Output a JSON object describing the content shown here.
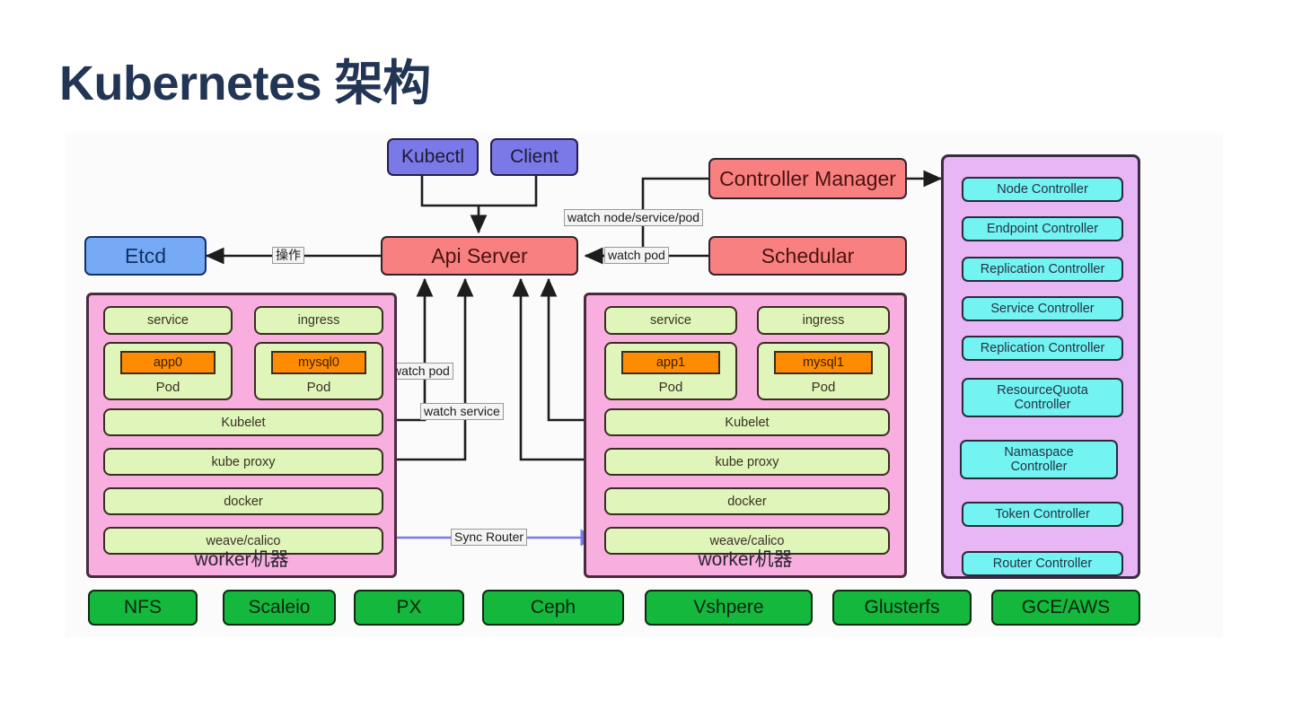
{
  "page": {
    "title": "Kubernetes 架构",
    "title_color": "#223555",
    "background": "#ffffff"
  },
  "colors": {
    "client_purple": "#7b78e8",
    "control_salmon": "#f98080",
    "etcd_blue": "#77aaf5",
    "controller_panel": "#e8b5f5",
    "controller_box": "#74f3f3",
    "worker_pink": "#f9aee0",
    "worker_green": "#dff5ba",
    "container_orange": "#ff8c00",
    "storage_green": "#14b83c",
    "sync_router_arrow": "#7b78e8"
  },
  "clients": [
    {
      "label": "Kubectl"
    },
    {
      "label": "Client"
    }
  ],
  "control_plane": {
    "api_server": "Api Server",
    "controller_manager": "Controller Manager",
    "schedular": "Schedular",
    "etcd": "Etcd"
  },
  "edge_labels": {
    "etcd_operation": "操作",
    "watch_node_service_pod": "watch node/service/pod",
    "watch_pod_schedular": "watch pod",
    "watch_pod_worker": "watch pod",
    "watch_service_worker": "watch service",
    "sync_router": "Sync Router"
  },
  "controllers": [
    {
      "label": "Node Controller",
      "lines": 1
    },
    {
      "label": "Endpoint Controller",
      "lines": 1
    },
    {
      "label": "Replication Controller",
      "lines": 1
    },
    {
      "label": "Service Controller",
      "lines": 1
    },
    {
      "label": "Replication Controller",
      "lines": 1
    },
    {
      "label": "ResourceQuota\nController",
      "lines": 2
    },
    {
      "label": "Namaspace\nController",
      "lines": 2
    },
    {
      "label": "Token Controller",
      "lines": 1
    },
    {
      "label": "Router Controller",
      "lines": 1
    }
  ],
  "workers": [
    {
      "title": "worker机器",
      "service": "service",
      "ingress": "ingress",
      "pods": [
        {
          "container": "app0",
          "label": "Pod"
        },
        {
          "container": "mysql0",
          "label": "Pod"
        }
      ],
      "components": [
        "Kubelet",
        "kube proxy",
        "docker",
        "weave/calico"
      ]
    },
    {
      "title": "worker机器",
      "service": "service",
      "ingress": "ingress",
      "pods": [
        {
          "container": "app1",
          "label": "Pod"
        },
        {
          "container": "mysql1",
          "label": "Pod"
        }
      ],
      "components": [
        "Kubelet",
        "kube proxy",
        "docker",
        "weave/calico"
      ]
    }
  ],
  "storage": [
    {
      "label": "NFS"
    },
    {
      "label": "Scaleio"
    },
    {
      "label": "PX"
    },
    {
      "label": "Ceph"
    },
    {
      "label": "Vshpere"
    },
    {
      "label": "Glusterfs"
    },
    {
      "label": "GCE/AWS"
    }
  ]
}
